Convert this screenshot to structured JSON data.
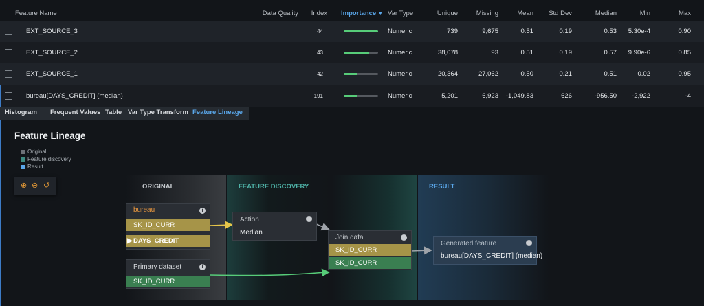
{
  "columns": {
    "feature_name": "Feature Name",
    "data_quality": "Data Quality",
    "index": "Index",
    "importance": "Importance",
    "var_type": "Var Type",
    "unique": "Unique",
    "missing": "Missing",
    "mean": "Mean",
    "std_dev": "Std Dev",
    "median": "Median",
    "min": "Min",
    "max": "Max"
  },
  "rows": [
    {
      "name": "EXT_SOURCE_3",
      "index": "44",
      "importance": 1.0,
      "var_type": "Numeric",
      "unique": "739",
      "missing": "9,675",
      "mean": "0.51",
      "std_dev": "0.19",
      "median": "0.53",
      "min": "5.30e-4",
      "max": "0.90"
    },
    {
      "name": "EXT_SOURCE_2",
      "index": "43",
      "importance": 0.74,
      "var_type": "Numeric",
      "unique": "38,078",
      "missing": "93",
      "mean": "0.51",
      "std_dev": "0.19",
      "median": "0.57",
      "min": "9.90e-6",
      "max": "0.85"
    },
    {
      "name": "EXT_SOURCE_1",
      "index": "42",
      "importance": 0.38,
      "var_type": "Numeric",
      "unique": "20,364",
      "missing": "27,062",
      "mean": "0.50",
      "std_dev": "0.21",
      "median": "0.51",
      "min": "0.02",
      "max": "0.95"
    },
    {
      "name": "bureau[DAYS_CREDIT] (median)",
      "index": "191",
      "importance": 0.38,
      "var_type": "Numeric",
      "unique": "5,201",
      "missing": "6,923",
      "mean": "-1,049.83",
      "std_dev": "626",
      "median": "-956.50",
      "min": "-2,922",
      "max": "-4"
    }
  ],
  "tabs": [
    "Histogram",
    "Frequent Values",
    "Table",
    "Var Type Transform",
    "Feature Lineage"
  ],
  "active_tab": "Feature Lineage",
  "lineage": {
    "title": "Feature Lineage",
    "legend": [
      {
        "label": "Original",
        "color": "#6d7177"
      },
      {
        "label": "Feature discovery",
        "color": "#3d8a80"
      },
      {
        "label": "Result",
        "color": "#5aa7ea"
      }
    ],
    "zoom_icons": [
      "zoom-in-icon",
      "zoom-out-icon",
      "reset-icon"
    ],
    "sections": {
      "original": "ORIGINAL",
      "feature_discovery": "FEATURE DISCOVERY",
      "result": "RESULT"
    },
    "bureau_node": {
      "title": "bureau",
      "fields": [
        "SK_ID_CURR",
        "DAYS_CREDIT"
      ]
    },
    "primary_node": {
      "title": "Primary dataset",
      "fields": [
        "SK_ID_CURR"
      ]
    },
    "action_node": {
      "title": "Action",
      "value": "Median"
    },
    "join_node": {
      "title": "Join data",
      "fields": [
        "SK_ID_CURR",
        "SK_ID_CURR"
      ]
    },
    "result_node": {
      "title": "Generated feature",
      "value": "bureau[DAYS_CREDIT] (median)"
    },
    "info_glyph": "i"
  },
  "colors": {
    "accent": "#5aa7ea",
    "importance_bar": "#57cc79",
    "bureau_title": "#e5953f",
    "link_yellow": "#e6c64a",
    "link_green": "#57cc79"
  }
}
